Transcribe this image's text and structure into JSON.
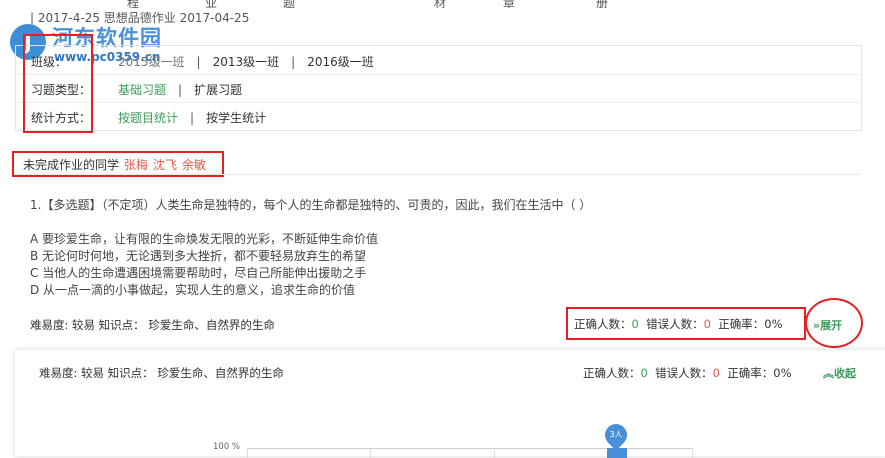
{
  "header_words": [
    "程",
    "业",
    "题",
    "材",
    "章",
    "册"
  ],
  "assignment_line": "| 2017-4-25 思想品德作业    2017-04-25",
  "watermark": {
    "logo_glyph": "J",
    "name": "河东软件园",
    "url": "www.pc0359.cn"
  },
  "filters": {
    "class": {
      "label": "班级：",
      "options": [
        "2015级一班",
        "2013级一班",
        "2016级一班"
      ],
      "separator": "|"
    },
    "type": {
      "label": "习题类型：",
      "options": [
        "基础习题",
        "扩展习题"
      ],
      "separator": "|"
    },
    "stat_mode": {
      "label": "统计方式：",
      "options": [
        "按题目统计",
        "按学生统计"
      ],
      "separator": "|"
    }
  },
  "unfinished": {
    "label": "未完成作业的同学",
    "names": [
      "张梅",
      "沈飞",
      "余敏"
    ]
  },
  "question": {
    "title": "1.【多选题】（不定项）人类生命是独特的，每个人的生命都是独特的、可贵的，因此，我们在生活中（      ）",
    "options": [
      "A 要珍爱生命，让有限的生命焕发无限的光彩，不断延伸生命价值",
      "B 无论何时何地，无论遇到多大挫折，都不要轻易放弃生的希望",
      "C 当他人的生命遭遇困境需要帮助时，尽自己所能伸出援助之手",
      "D 从一点一滴的小事做起，实现人生的意义，追求生命的价值"
    ],
    "meta": "难易度: 较易 知识点： 珍爱生命、自然界的生命",
    "stats": {
      "correct_label": "正确人数：",
      "correct_value": "0",
      "wrong_label": "错误人数：",
      "wrong_value": "0",
      "rate_label": "正确率：",
      "rate_value": "0%"
    },
    "expand_label": "展开",
    "collapse_label": "收起"
  },
  "chart_data": {
    "type": "bar",
    "ytick_top": "100 %",
    "bar_label": "3人",
    "values": [
      3
    ]
  },
  "colors": {
    "accent_green": "#3a9c5a",
    "highlight_red": "#e22222",
    "name_red": "#e0574f",
    "bar_blue": "#4a90d9"
  }
}
